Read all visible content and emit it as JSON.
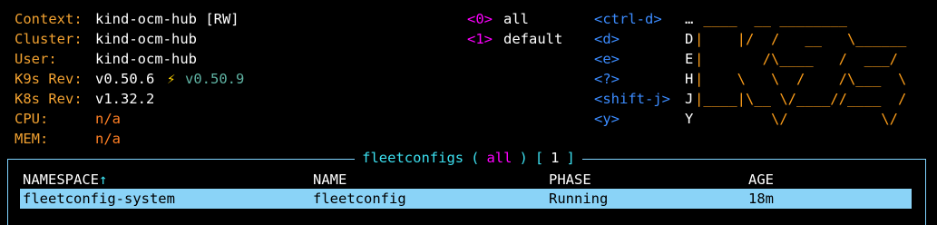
{
  "info": {
    "context_label": "Context:",
    "context_value": "kind-ocm-hub [RW]",
    "cluster_label": "Cluster:",
    "cluster_value": "kind-ocm-hub",
    "user_label": "User:",
    "user_value": "kind-ocm-hub",
    "k9s_label": "K9s Rev:",
    "k9s_value": "v0.50.6",
    "k9s_update_icon": "lightning-icon",
    "k9s_update_glyph": "⚡",
    "k9s_latest": "v0.50.9",
    "k8s_label": "K8s Rev:",
    "k8s_value": "v1.32.2",
    "cpu_label": "CPU:",
    "cpu_value": "n/a",
    "mem_label": "MEM:",
    "mem_value": "n/a"
  },
  "namespaces": [
    {
      "key": "<0>",
      "name": "all"
    },
    {
      "key": "<1>",
      "name": "default"
    }
  ],
  "hotkeys": [
    {
      "key": "<ctrl-d>",
      "action": "…"
    },
    {
      "key": "<d>",
      "action": "D"
    },
    {
      "key": "<e>",
      "action": "E"
    },
    {
      "key": "<?>",
      "action": "H"
    },
    {
      "key": "<shift-j>",
      "action": "J"
    },
    {
      "key": "<y>",
      "action": "Y"
    }
  ],
  "logo_lines": [
    " ____  __ ________ ",
    "|    |/  /   __   \\______",
    "|       /\\____   /  ___/",
    "|    \\   \\  /    /\\___  \\",
    "|____|\\__ \\/____//____  /",
    "         \\/           \\/"
  ],
  "table": {
    "resource": "fleetconfigs",
    "scope": "all",
    "count": "1",
    "columns": [
      "NAMESPACE",
      "NAME",
      "PHASE",
      "AGE"
    ],
    "sort_arrow": "↑",
    "rows": [
      [
        "fleetconfig-system",
        "fleetconfig",
        "Running",
        "18m"
      ]
    ]
  },
  "colors": {
    "label": "#f0a030",
    "namespace_key": "#ff00ff",
    "hotkey": "#3c8cff",
    "logo": "#ff9f1a",
    "selected_row": "#8ad3f7",
    "border": "#7fd3ff"
  }
}
